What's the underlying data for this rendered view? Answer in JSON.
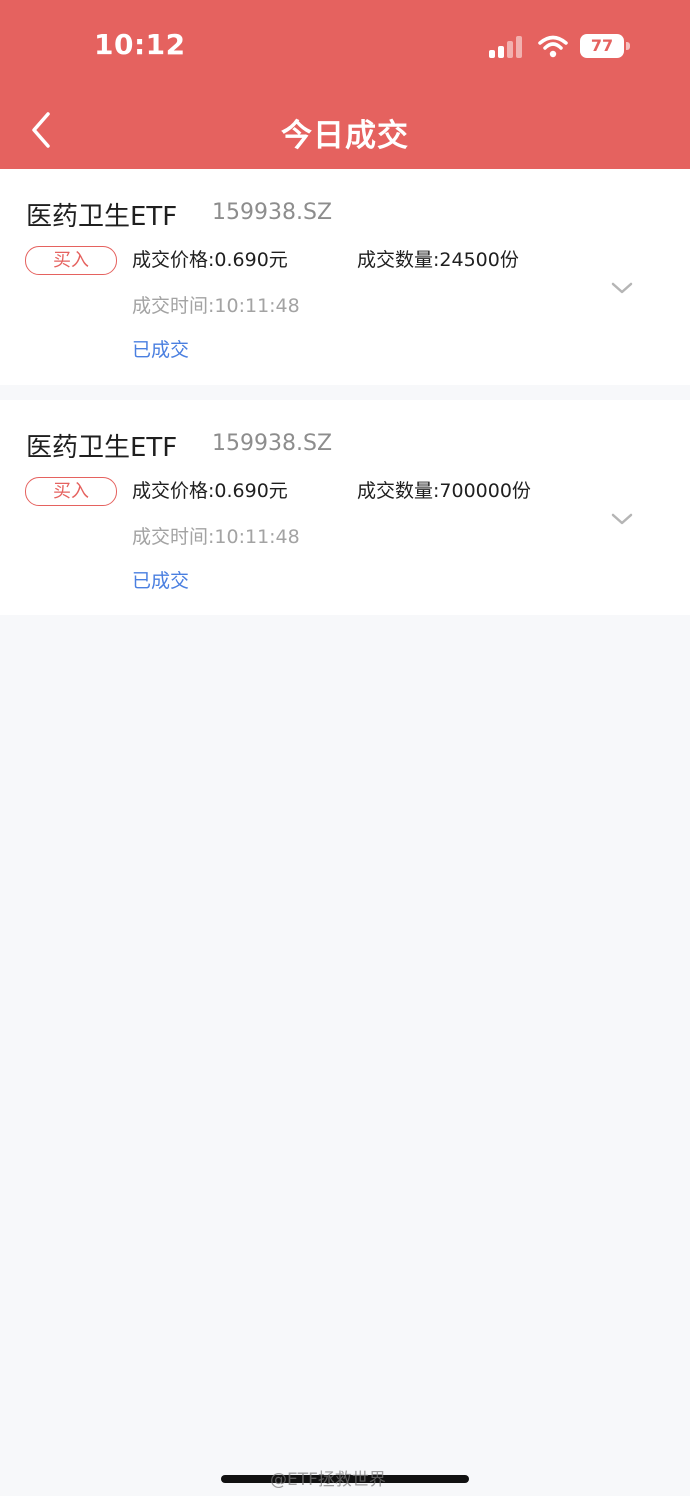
{
  "status_bar": {
    "time": "10:12",
    "battery": "77",
    "icons": [
      "signal-icon",
      "wifi-icon",
      "battery-icon"
    ]
  },
  "header": {
    "title": "今日成交",
    "back_icon": "chevron-left-icon",
    "background_color": "#e5625f"
  },
  "trades": [
    {
      "name": "医药卫生ETF",
      "code": "159938.SZ",
      "side": "买入",
      "price": "成交价格:0.690元",
      "quantity": "成交数量:24500份",
      "time": "成交时间:10:11:48",
      "status": "已成交"
    },
    {
      "name": "医药卫生ETF",
      "code": "159938.SZ",
      "side": "买入",
      "price": "成交价格:0.690元",
      "quantity": "成交数量:700000份",
      "time": "成交时间:10:11:48",
      "status": "已成交"
    }
  ],
  "watermark": "@ETF拯救世界",
  "colors": {
    "accent": "#e5625f",
    "status_link": "#4a7fe0",
    "muted_text": "#a3a3a3"
  }
}
